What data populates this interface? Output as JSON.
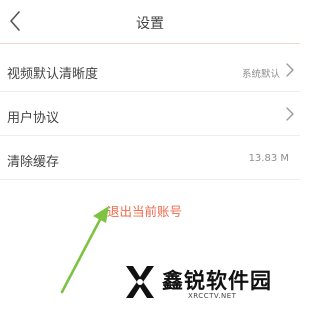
{
  "header": {
    "title": "设置",
    "back_icon": "chevron-left-icon"
  },
  "settings": {
    "items": [
      {
        "label": "视频默认清晰度",
        "value": "系统默认",
        "icon": "chevron-right-icon"
      },
      {
        "label": "用户协议",
        "value": "",
        "icon": "chevron-right-icon"
      },
      {
        "label": "清除缓存",
        "value": "13.83 M"
      }
    ]
  },
  "logout": {
    "label": "退出当前账号",
    "color": "#f26a4b"
  },
  "annotation": {
    "arrow_color": "#7ec242",
    "icon": "arrow-up-icon"
  },
  "watermark": {
    "brand_name": "鑫锐软件园",
    "domain": "XRCCTV.NET"
  }
}
